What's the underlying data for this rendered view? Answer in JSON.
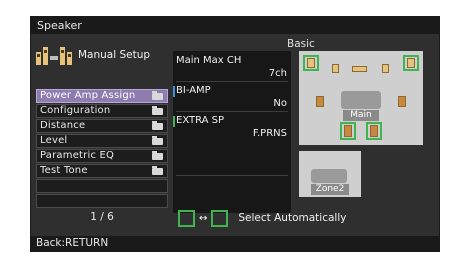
{
  "window": {
    "title": "Speaker"
  },
  "header": {
    "title": "Manual Setup",
    "icon": "speaker-setup-icon"
  },
  "menu": {
    "items": [
      {
        "label": "Power Amp Assign",
        "selected": true
      },
      {
        "label": "Configuration",
        "selected": false
      },
      {
        "label": "Distance",
        "selected": false
      },
      {
        "label": "Level",
        "selected": false
      },
      {
        "label": "Parametric EQ",
        "selected": false
      },
      {
        "label": "Test Tone",
        "selected": false
      }
    ],
    "pager": "1 / 6"
  },
  "basic": {
    "title": "Basic",
    "params": [
      {
        "label": "Main Max CH",
        "value": "7ch"
      },
      {
        "label": "BI-AMP",
        "value": "No"
      },
      {
        "label": "EXTRA SP",
        "value": "F.PRNS"
      }
    ]
  },
  "diagram": {
    "main_label": "Main",
    "zone2_label": "Zone2"
  },
  "auto": {
    "arrow": "↔",
    "label": "Select Automatically"
  },
  "status": {
    "back_label": "Back:RETURN"
  },
  "colors": {
    "selected": "#8e7bb0",
    "green_highlight": "#3fb44f",
    "blue_bar": "#3f8fd8"
  }
}
